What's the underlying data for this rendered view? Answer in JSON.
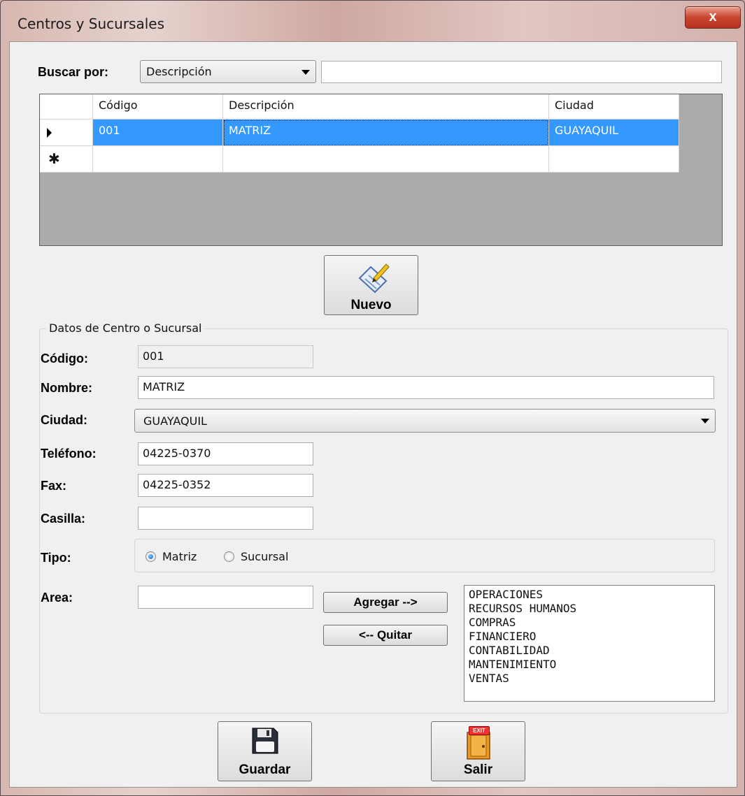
{
  "window": {
    "title": "Centros y Sucursales",
    "close_label": "x"
  },
  "search": {
    "label": "Buscar por:",
    "field_selected": "Descripción",
    "query": ""
  },
  "grid": {
    "columns": [
      "Código",
      "Descripción",
      "Ciudad"
    ],
    "rows": [
      {
        "codigo": "001",
        "descripcion": "MATRIZ",
        "ciudad": "GUAYAQUIL"
      }
    ],
    "new_row_marker": "✱"
  },
  "toolbar": {
    "nuevo_label": "Nuevo"
  },
  "form": {
    "group_title": "Datos de Centro o Sucursal",
    "codigo_label": "Código:",
    "codigo_value": "001",
    "nombre_label": "Nombre:",
    "nombre_value": "MATRIZ",
    "ciudad_label": "Ciudad:",
    "ciudad_value": "GUAYAQUIL",
    "telefono_label": "Teléfono:",
    "telefono_value": "04225-0370",
    "fax_label": "Fax:",
    "fax_value": "04225-0352",
    "casilla_label": "Casilla:",
    "casilla_value": "",
    "tipo_label": "Tipo:",
    "tipo_options": [
      "Matriz",
      "Sucursal"
    ],
    "tipo_selected": "Matriz",
    "area_label": "Area:",
    "area_value": "",
    "agregar_label": "Agregar -->",
    "quitar_label": "<-- Quitar",
    "areas": [
      "OPERACIONES",
      "RECURSOS HUMANOS",
      "COMPRAS",
      "FINANCIERO",
      "CONTABILIDAD",
      "MANTENIMIENTO",
      "VENTAS"
    ]
  },
  "footer": {
    "guardar_label": "Guardar",
    "salir_label": "Salir",
    "exit_sign": "EXIT"
  },
  "colors": {
    "selection": "#3399ff",
    "title_close": "#c9452f"
  }
}
